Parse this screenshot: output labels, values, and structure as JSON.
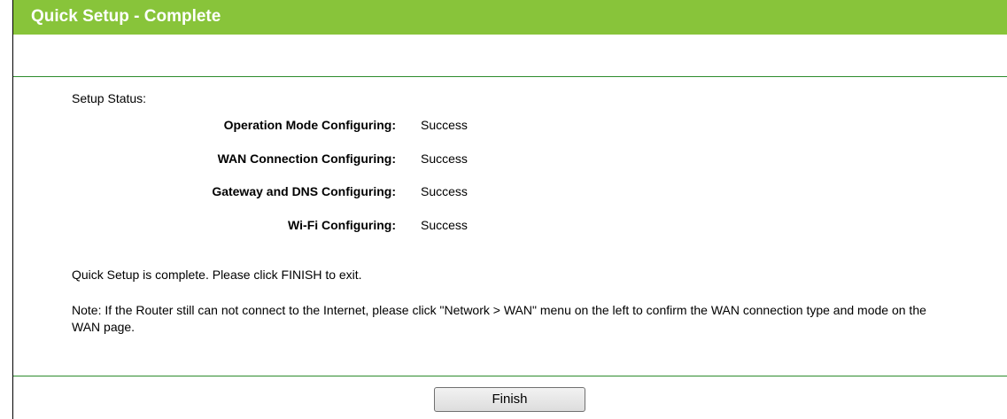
{
  "header": {
    "title": "Quick Setup - Complete",
    "color": "#88c43a"
  },
  "status": {
    "heading": "Setup Status:",
    "items": [
      {
        "label": "Operation Mode Configuring:",
        "value": "Success"
      },
      {
        "label": "WAN Connection Configuring:",
        "value": "Success"
      },
      {
        "label": "Gateway and DNS Configuring:",
        "value": "Success"
      },
      {
        "label": "Wi-Fi Configuring:",
        "value": "Success"
      }
    ]
  },
  "messages": {
    "complete": "Quick Setup is complete. Please click FINISH to exit.",
    "note": "Note: If the Router still can not connect to the Internet, please click \"Network > WAN\" menu on the left to confirm the WAN connection type and mode on the WAN page."
  },
  "buttons": {
    "finish_label": "Finish"
  },
  "colors": {
    "divider": "#2d8b2d"
  }
}
